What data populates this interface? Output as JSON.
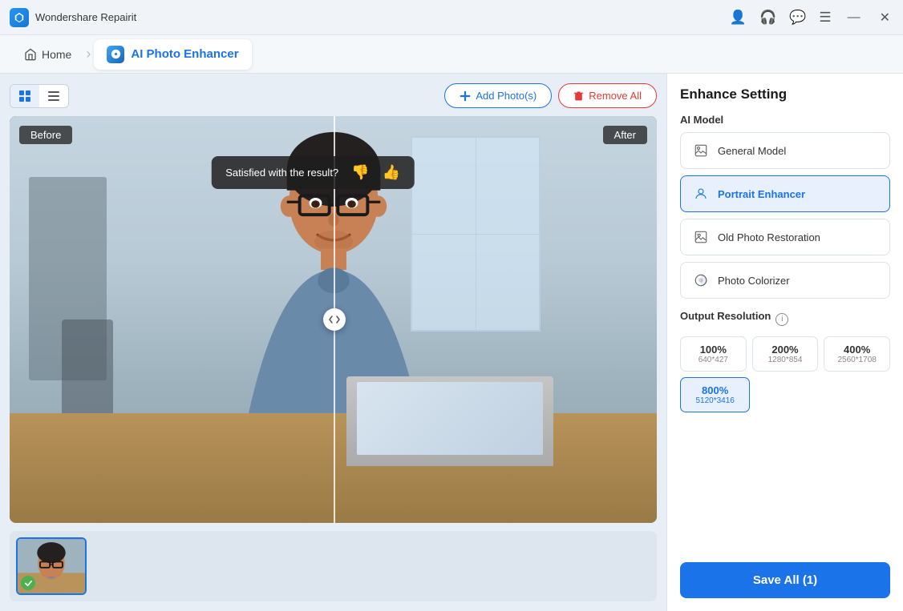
{
  "app": {
    "name": "Wondershare Repairit",
    "icon": "repair-icon"
  },
  "titlebar": {
    "title": "Wondershare Repairit",
    "controls": {
      "account": "👤",
      "headset": "🎧",
      "chat": "💬",
      "menu": "☰",
      "minimize": "—",
      "close": "✕"
    }
  },
  "navbar": {
    "home_label": "Home",
    "active_tab": "AI Photo Enhancer",
    "tab_icon": "enhancer-icon"
  },
  "toolbar": {
    "add_photos_label": "+ Add Photo(s)",
    "remove_all_label": "🗑 Remove All",
    "grid_view": "grid-icon",
    "list_view": "list-icon"
  },
  "viewer": {
    "before_label": "Before",
    "after_label": "After",
    "satisfaction_text": "Satisfied with the result?",
    "thumbs_up": "👍",
    "thumbs_down": "👎"
  },
  "right_panel": {
    "title": "Enhance Setting",
    "ai_model_label": "AI Model",
    "models": [
      {
        "id": "general",
        "label": "General Model",
        "active": false
      },
      {
        "id": "portrait",
        "label": "Portrait Enhancer",
        "active": true
      },
      {
        "id": "old_photo",
        "label": "Old Photo Restoration",
        "active": false
      },
      {
        "id": "colorizer",
        "label": "Photo Colorizer",
        "active": false
      }
    ],
    "output_resolution_label": "Output Resolution",
    "resolutions": [
      {
        "pct": "100%",
        "dim": "640*427",
        "active": false
      },
      {
        "pct": "200%",
        "dim": "1280*854",
        "active": false
      },
      {
        "pct": "400%",
        "dim": "2560*1708",
        "active": false
      }
    ],
    "selected_resolution": {
      "pct": "800%",
      "dim": "5120*3416",
      "active": true
    },
    "save_all_label": "Save All (1)"
  }
}
